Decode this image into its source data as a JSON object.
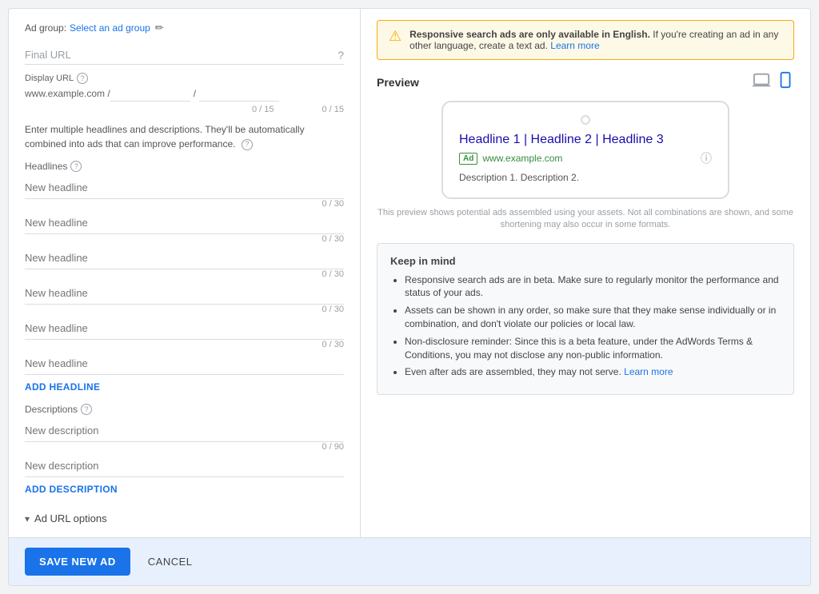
{
  "adGroup": {
    "label": "Ad group:",
    "selectText": "Select an ad group"
  },
  "finalUrl": {
    "label": "Final URL",
    "placeholder": ""
  },
  "displayUrl": {
    "label": "Display URL",
    "prefix": "www.example.com /",
    "input1Placeholder": "",
    "input2Placeholder": "",
    "slash": "/",
    "counter1": "0 / 15",
    "counter2": "0 / 15"
  },
  "infoText": "Enter multiple headlines and descriptions. They'll be automatically combined into ads that can improve performance.",
  "headlines": {
    "label": "Headlines",
    "items": [
      {
        "placeholder": "New headline",
        "counter": ""
      },
      {
        "placeholder": "New headline",
        "counter": "0 / 30"
      },
      {
        "placeholder": "New headline",
        "counter": "0 / 30"
      },
      {
        "placeholder": "New headline",
        "counter": "0 / 30"
      },
      {
        "placeholder": "New headline",
        "counter": "0 / 30"
      },
      {
        "placeholder": "New headline",
        "counter": "0 / 30"
      }
    ],
    "addLabel": "ADD HEADLINE"
  },
  "descriptions": {
    "label": "Descriptions",
    "items": [
      {
        "placeholder": "New description",
        "counter": ""
      },
      {
        "placeholder": "New description",
        "counter": "0 / 90"
      }
    ],
    "addLabel": "ADD DESCRIPTION"
  },
  "urlOptions": {
    "label": "Ad URL options"
  },
  "footer": {
    "saveLabel": "SAVE NEW AD",
    "cancelLabel": "CANCEL"
  },
  "warning": {
    "text": "Responsive search ads are only available in English.",
    "subtext": " If you're creating an ad in any other language, create a text ad.",
    "learnMore": "Learn more"
  },
  "preview": {
    "title": "Preview",
    "headline": "Headline 1 | Headline 2 | Headline 3",
    "url": "www.example.com",
    "description": "Description 1. Description 2.",
    "note": "This preview shows potential ads assembled using your assets. Not all combinations are shown, and some shortening may also occur in some formats."
  },
  "keepInMind": {
    "title": "Keep in mind",
    "bullets": [
      "Responsive search ads are in beta. Make sure to regularly monitor the performance and status of your ads.",
      "Assets can be shown in any order, so make sure that they make sense individually or in combination, and don't violate our policies or local law.",
      "Non-disclosure reminder: Since this is a beta feature, under the AdWords Terms & Conditions, you may not disclose any non-public information.",
      "Even after ads are assembled, they may not serve."
    ],
    "learnMoreText": "Learn more",
    "lastBulletLinkIndex": 3
  }
}
